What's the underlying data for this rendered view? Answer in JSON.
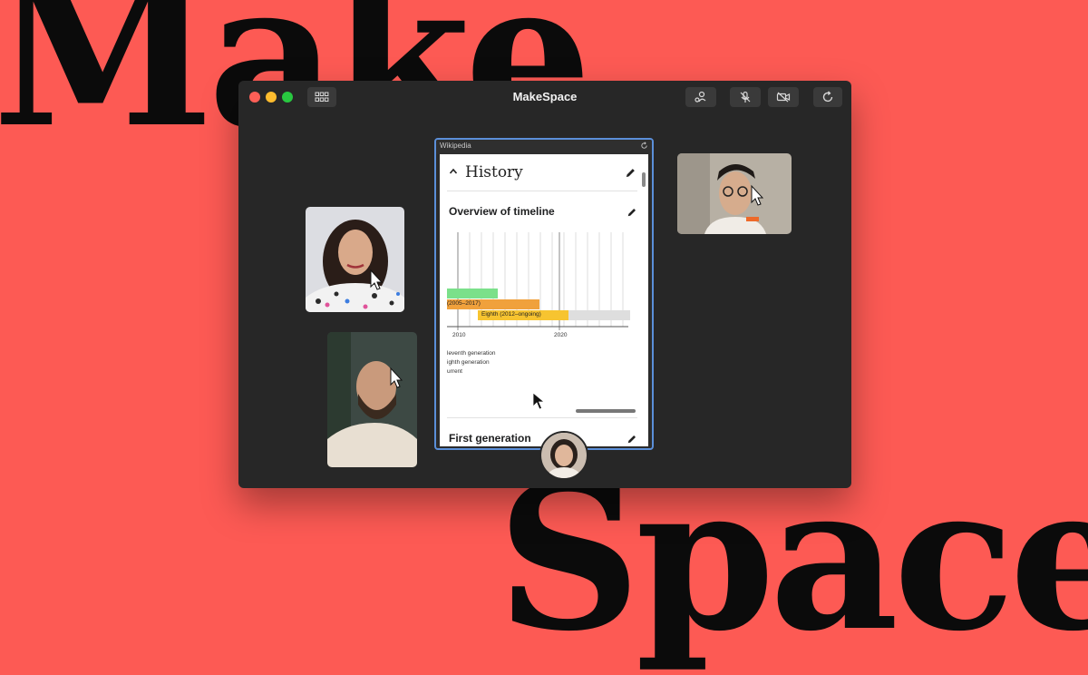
{
  "background": {
    "word_top": "Make",
    "word_bottom": "Space",
    "color": "#fd5a54"
  },
  "window": {
    "title": "MakeSpace",
    "toolbar_icons": [
      "grid-icon",
      "share-icon",
      "mic-muted-icon",
      "camera-off-icon",
      "reload-icon"
    ]
  },
  "browser": {
    "tab_label": "Wikipedia",
    "section_title": "History",
    "subsection_title": "Overview of timeline",
    "next_section_title": "First generation",
    "timeline": {
      "bars": [
        {
          "label": "",
          "color": "#7be08a"
        },
        {
          "label": "(2005–2017)",
          "color": "#f0a13c"
        },
        {
          "label": "Eighth (2012–ongoing)",
          "color": "#f7c430"
        }
      ],
      "axis_ticks": [
        "2010",
        "2020"
      ],
      "legend": [
        "leventh generation",
        "ighth generation",
        "urrent"
      ]
    }
  },
  "participants": [
    {
      "name": "participant-woman"
    },
    {
      "name": "participant-man-glasses"
    },
    {
      "name": "participant-man-beard"
    },
    {
      "name": "participant-avatar"
    }
  ],
  "colors": {
    "accent_border": "#5b8fd9",
    "window_bg": "#272727"
  }
}
